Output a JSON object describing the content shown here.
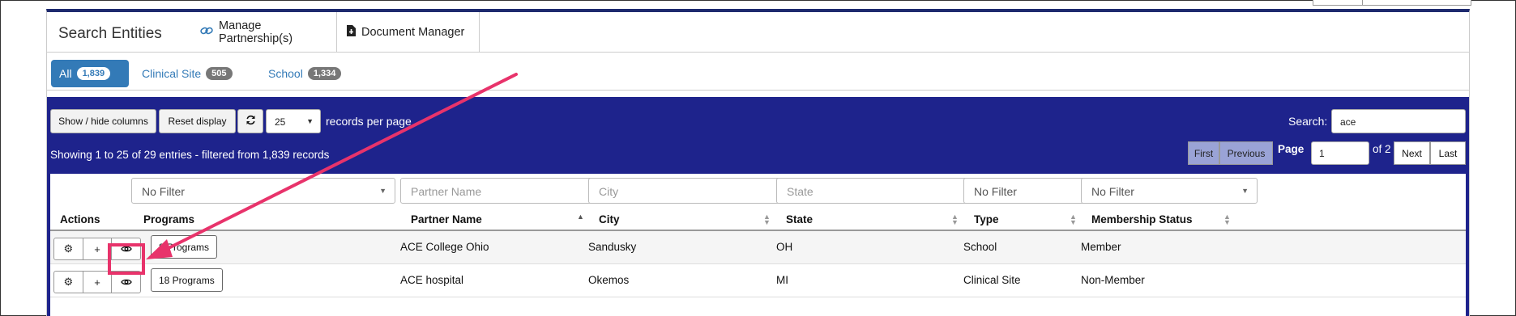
{
  "header": {
    "title": "Search Entities",
    "manage_partnerships": "Manage Partnership(s)",
    "document_manager": "Document Manager"
  },
  "filters": [
    {
      "label": "All",
      "count": "1,839",
      "active": true
    },
    {
      "label": "Clinical Site",
      "count": "505",
      "active": false
    },
    {
      "label": "School",
      "count": "1,334",
      "active": false
    }
  ],
  "toolbar": {
    "show_hide_columns": "Show / hide columns",
    "reset_display": "Reset display",
    "records_per_page_value": "25",
    "records_per_page_label": "records per page",
    "search_label": "Search:",
    "search_value": "ace",
    "showing_text": "Showing 1 to 25 of 29 entries - filtered from 1,839 records"
  },
  "pagination": {
    "first": "First",
    "previous": "Previous",
    "page_label": "Page",
    "page_value": "1",
    "of_text": "of 2",
    "next": "Next",
    "last": "Last"
  },
  "column_filters": {
    "programs": "No Filter",
    "partner_name_placeholder": "Partner Name",
    "city_placeholder": "City",
    "state_placeholder": "State",
    "type": "No Filter",
    "membership": "No Filter"
  },
  "columns": [
    "Actions",
    "Programs",
    "Partner Name",
    "City",
    "State",
    "Type",
    "Membership Status"
  ],
  "rows": [
    {
      "programs": "8 Programs",
      "partner_name": "ACE College Ohio",
      "city": "Sandusky",
      "state": "OH",
      "type": "School",
      "membership": "Member"
    },
    {
      "programs": "18 Programs",
      "partner_name": "ACE hospital",
      "city": "Okemos",
      "state": "MI",
      "type": "Clinical Site",
      "membership": "Non-Member"
    }
  ],
  "colors": {
    "header_band": "#1e238c",
    "accent": "#337ab7",
    "annotation": "#e8336b"
  }
}
